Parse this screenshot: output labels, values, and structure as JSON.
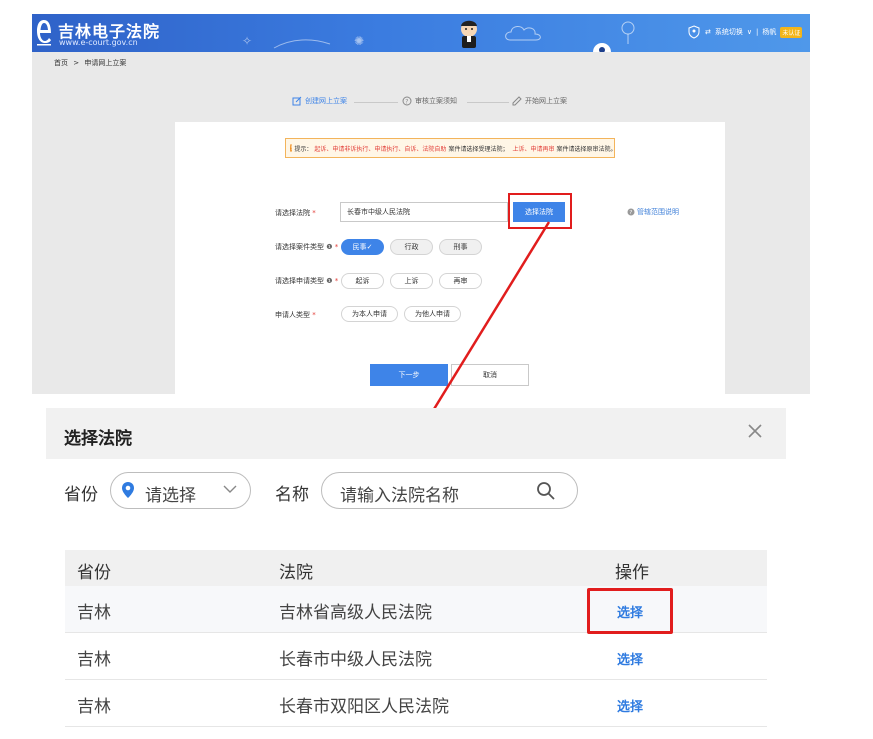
{
  "portal": {
    "title": "吉林电子法院",
    "url": "www.e-court.gov.cn",
    "header_right": {
      "switch_label": "系统切换",
      "user_name": "杨帆",
      "badge": "未认证"
    }
  },
  "breadcrumb": {
    "home": "首页",
    "separator": ">",
    "current": "申请网上立案"
  },
  "steps": [
    {
      "label": "创建网上立案",
      "active": true
    },
    {
      "label": "审核立案须知",
      "active": false
    },
    {
      "label": "开始网上立案",
      "active": false
    }
  ],
  "tip": {
    "prefix": "提示：",
    "highlight1": "起诉、申请非诉执行、申请执行、自诉、法院自助",
    "mid": "案件请选择受理法院；",
    "highlight2": "上诉、申请再审",
    "suffix": "案件请选择原审法院。"
  },
  "form": {
    "court_label": "请选择法院",
    "court_value": "长春市中级人民法院",
    "court_button": "选择法院",
    "scope_link": "管辖范围说明",
    "case_type_label": "请选择案件类型",
    "case_types": [
      {
        "label": "民事",
        "selected": true
      },
      {
        "label": "行政",
        "selected": false
      },
      {
        "label": "刑事",
        "selected": false
      }
    ],
    "apply_type_label": "请选择申请类型",
    "apply_types": [
      {
        "label": "起诉",
        "selected": false
      },
      {
        "label": "上诉",
        "selected": false
      },
      {
        "label": "再审",
        "selected": false
      }
    ],
    "applicant_label": "申请人类型",
    "applicant_types": [
      {
        "label": "为本人申请",
        "selected": false
      },
      {
        "label": "为他人申请",
        "selected": false
      }
    ],
    "required_mark": "*",
    "next_button": "下一步",
    "cancel_button": "取消"
  },
  "modal": {
    "title": "选择法院",
    "province_label": "省份",
    "province_placeholder": "请选择",
    "name_label": "名称",
    "name_placeholder": "请输入法院名称",
    "table": {
      "headers": [
        "省份",
        "法院",
        "操作"
      ],
      "rows": [
        {
          "province": "吉林",
          "court": "吉林省高级人民法院",
          "action": "选择"
        },
        {
          "province": "吉林",
          "court": "长春市中级人民法院",
          "action": "选择"
        },
        {
          "province": "吉林",
          "court": "长春市双阳区人民法院",
          "action": "选择"
        }
      ]
    }
  },
  "colors": {
    "primary": "#3e84e8",
    "header_blue": "#2f62c8",
    "highlight_red": "#e11d1d",
    "warning_orange": "#f08c1a",
    "link_blue": "#2f7be0"
  }
}
